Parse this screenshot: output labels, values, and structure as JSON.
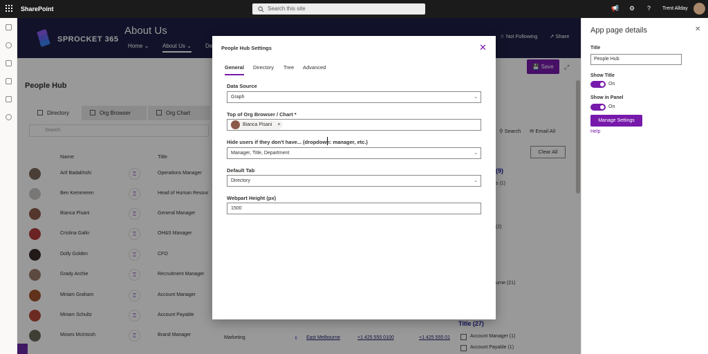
{
  "suite": {
    "app_name": "SharePoint",
    "search_placeholder": "Search this site",
    "user_name": "Trent Allday"
  },
  "header": {
    "logo_text": "SPROCKET 365",
    "site_title": "About Us",
    "nav": [
      "Home",
      "About Us",
      "De"
    ],
    "follow_label": "Not Following",
    "share_label": "Share"
  },
  "page": {
    "title": "People Hub",
    "save_label": "Save"
  },
  "people_hub": {
    "tabs": [
      "Directory",
      "Org Browser",
      "Org Chart"
    ],
    "search_placeholder": "Search",
    "search_label": "Search",
    "email_all_label": "Email All",
    "clear_all_label": "Clear All",
    "columns": [
      "Name",
      "Title"
    ],
    "rows": [
      {
        "name": "Arif Badakhshi",
        "title": "Operations Manager",
        "avatar_color": "#7a6a5a"
      },
      {
        "name": "Ben Kemmeren",
        "title": "Head of Human Resour",
        "avatar_color": "#c8c6c4"
      },
      {
        "name": "Bianca Pisani",
        "title": "General Manager",
        "avatar_color": "#8c5a4a"
      },
      {
        "name": "Cristina Gallo",
        "title": "OH&S Manager",
        "avatar_color": "#b23b3b"
      },
      {
        "name": "Dolly Golden",
        "title": "CFO",
        "avatar_color": "#3a2a2a"
      },
      {
        "name": "Grady Archie",
        "title": "Recruitment Manager",
        "avatar_color": "#9a7a6a"
      },
      {
        "name": "Miriam Graham",
        "title": "Account Manager",
        "avatar_color": "#a0522d"
      },
      {
        "name": "Miriam Schultz",
        "title": "Account Payable",
        "avatar_color": "#b5483a"
      },
      {
        "name": "Moses McIntosh",
        "title": "Brand Manager",
        "avatar_color": "#6a6a5a"
      }
    ],
    "last_row_extra": {
      "department": "Marketing",
      "location": "East Melbourne",
      "phone1": "+1 425 555 0100",
      "phone2": "+1 425 555 01"
    },
    "facets": {
      "first_count": "(9)",
      "first_item": "s (1)",
      "second_item": "(2)",
      "third_item": "urne (21)",
      "title_heading": "Title (27)",
      "title_items": [
        "Account Manager (1)",
        "Account Payable (1)"
      ]
    }
  },
  "panel": {
    "heading": "App page details",
    "title_label": "Title",
    "title_value": "People Hub",
    "show_title_label": "Show Title",
    "show_title_state": "On",
    "show_in_panel_label": "Show in Panel",
    "show_in_panel_state": "On",
    "manage_label": "Manage Settings",
    "help_label": "Help"
  },
  "modal": {
    "title": "People Hub Settings",
    "tabs": [
      "General",
      "Directory",
      "Tree",
      "Advanced"
    ],
    "data_source_label": "Data Source",
    "data_source_value": "Graph",
    "top_label": "Top of Org Browser / Chart *",
    "top_person": "Bianca Pisani",
    "hide_label": "Hide users if they don't have... (dropdown: manager, etc.)",
    "hide_value": "Manager, Title, Department",
    "default_tab_label": "Default Tab",
    "default_tab_value": "Directory",
    "height_label": "Webpart Height (px)",
    "height_value": "1500"
  },
  "colors": {
    "accent": "#7719aa",
    "header_bg": "#1f2147",
    "suitebar_bg": "#1b1b1b"
  }
}
